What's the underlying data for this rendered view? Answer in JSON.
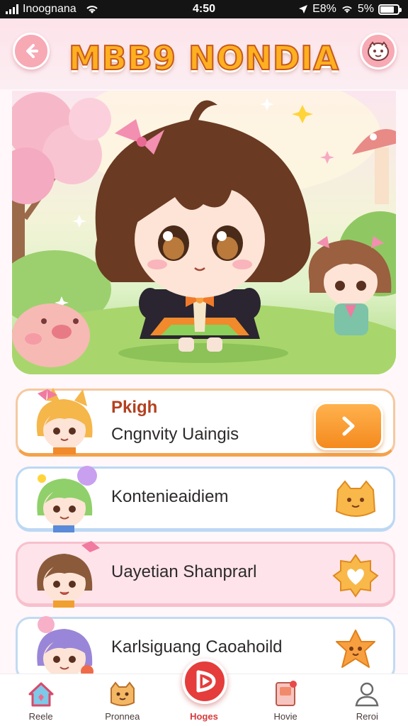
{
  "status_bar": {
    "carrier": "Inoognana",
    "time": "4:50",
    "battery_text": "E8%",
    "wifi_text": "5%",
    "battery_level": 0.8
  },
  "header": {
    "title": "MBB9 NONDIA",
    "back_icon": "back-arrow-icon",
    "profile_icon": "face-icon"
  },
  "cards": [
    {
      "title": "Pkigh",
      "subtitle": "Cngnvity Uaingis",
      "action_icon": "chevron-right-icon"
    },
    {
      "label": "Kontenieaidiem",
      "icon": "cat-badge-icon"
    },
    {
      "label": "Uayetian Shanprarl",
      "icon": "heart-badge-icon"
    },
    {
      "label": "Karlsiguang Caoahoild",
      "icon": "star-badge-icon"
    }
  ],
  "tabs": [
    {
      "label": "Reele",
      "icon": "house-icon"
    },
    {
      "label": "Pronnea",
      "icon": "cat-icon"
    },
    {
      "label": "Hoges",
      "icon": "play-icon",
      "active": true
    },
    {
      "label": "Hovie",
      "icon": "book-icon"
    },
    {
      "label": "Reroi",
      "icon": "person-icon"
    }
  ],
  "colors": {
    "accent": "#f48a1e",
    "title_fill": "#ffb020",
    "title_stroke": "#c65a1e",
    "active_tab": "#e53c3c",
    "pink": "#f7a9b4"
  }
}
